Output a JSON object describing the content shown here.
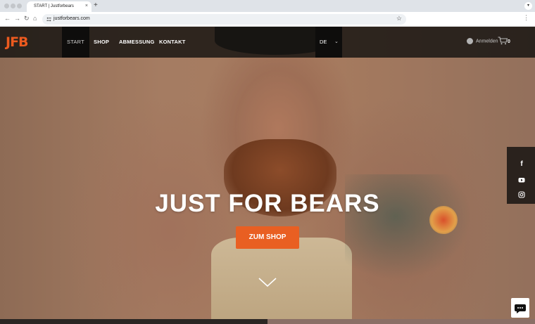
{
  "browser": {
    "tab_title": "START | Justforbears",
    "tab_close": "×",
    "new_tab": "+",
    "url": "justforbears.com",
    "tab_menu": "▾"
  },
  "site": {
    "logo": "JFB",
    "nav": [
      "START",
      "SHOP",
      "ABMESSUNG",
      "KONTAKT"
    ],
    "active_nav": "START",
    "language": "DE",
    "login_label": "Anmelden",
    "cart_count": "0",
    "social": [
      "facebook-icon",
      "youtube-icon",
      "instagram-icon"
    ],
    "hero_title": "JUST FOR BEARS",
    "cta_label": "ZUM SHOP"
  },
  "colors": {
    "accent": "#e95f22",
    "header_bg": "#141210",
    "logo": "#ec5a1f"
  }
}
